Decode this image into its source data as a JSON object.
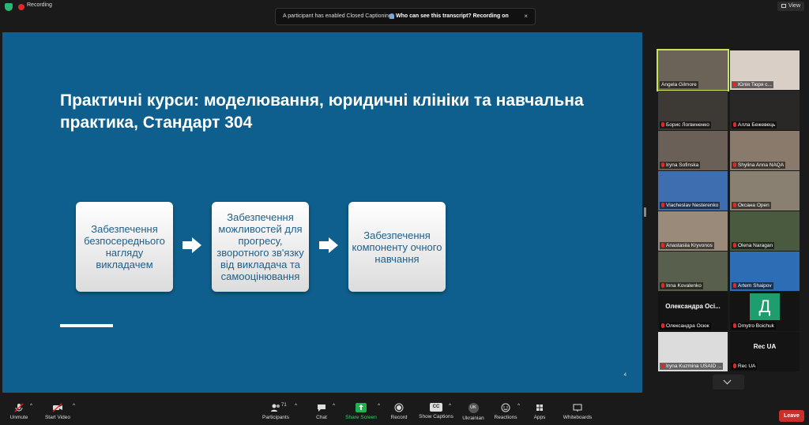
{
  "topbar": {
    "recording_label": "Recording",
    "view_label": "View",
    "banner_message": "A participant has enabled Closed Captioning",
    "banner_link": "Who can see this transcript? Recording on",
    "banner_close": "×"
  },
  "slide": {
    "title": "Практичні курси: моделювання, юридичні клініки та навчальна практика, Стандарт 304",
    "cards": [
      "Забезпечення безпосереднього нагляду викладачем",
      "Забезпечення можливостей для прогресу, зворотного зв'язку від викладача та самооцінювання",
      "Забезпечення компоненту очного навчання"
    ],
    "page_number": "4"
  },
  "gallery": {
    "participants": [
      {
        "name": "Angela Gilmore",
        "muted": false,
        "bg": "#6b6357",
        "active": true
      },
      {
        "name": "Юлія Тюря с...",
        "muted": true,
        "bg": "#d9cfc7"
      },
      {
        "name": "Борис Логвиненко",
        "muted": true,
        "bg": "#3d3a36"
      },
      {
        "name": "Алла Бежевець",
        "muted": true,
        "bg": "#2a2826"
      },
      {
        "name": "Iryna Sofinska",
        "muted": true,
        "bg": "#6a6058"
      },
      {
        "name": "Shylina Anna NAQA",
        "muted": true,
        "bg": "#8a7a6c"
      },
      {
        "name": "Viacheslav Nesterenko",
        "muted": true,
        "bg": "#3e6eb0"
      },
      {
        "name": "Оксана Open",
        "muted": true,
        "bg": "#8a8071"
      },
      {
        "name": "Anastasiia Kryvonos",
        "muted": true,
        "bg": "#9a8a7a"
      },
      {
        "name": "Olena Naragan",
        "muted": true,
        "bg": "#4a5a3e"
      },
      {
        "name": "Inna Kovalenko",
        "muted": true,
        "bg": "#595f4d"
      },
      {
        "name": "Artem Shaipov",
        "muted": true,
        "bg": "#2d6db5"
      },
      {
        "name": "Олександра Осюк",
        "muted": true,
        "bg": "#141414",
        "display_text": "Олександра Осі..."
      },
      {
        "name": "Dmytro Boichuk",
        "muted": true,
        "bg": "#141414",
        "letter": "Д"
      },
      {
        "name": "Iryna Kuzmina USAID ...",
        "muted": true,
        "bg": "#dcdcdc"
      },
      {
        "name": "Rec UA",
        "muted": true,
        "bg": "#141414",
        "display_text": "Rec UA"
      }
    ]
  },
  "toolbar": {
    "unmute": "Unmute",
    "start_video": "Start Video",
    "participants": "Participants",
    "participants_count": "71",
    "chat": "Chat",
    "share_screen": "Share Screen",
    "record": "Record",
    "show_captions": "Show Captions",
    "ukrainian": "Ukrainian",
    "ukrainian_badge": "UK",
    "reactions": "Reactions",
    "apps": "Apps",
    "whiteboards": "Whiteboards",
    "leave": "Leave",
    "cc_badge": "CC"
  },
  "colors": {
    "slide_bg": "#0e5f8d",
    "card_text": "#1f5f8b",
    "active_speaker": "#c7e55a",
    "leave": "#c9302c",
    "share_green": "#22b14c"
  }
}
